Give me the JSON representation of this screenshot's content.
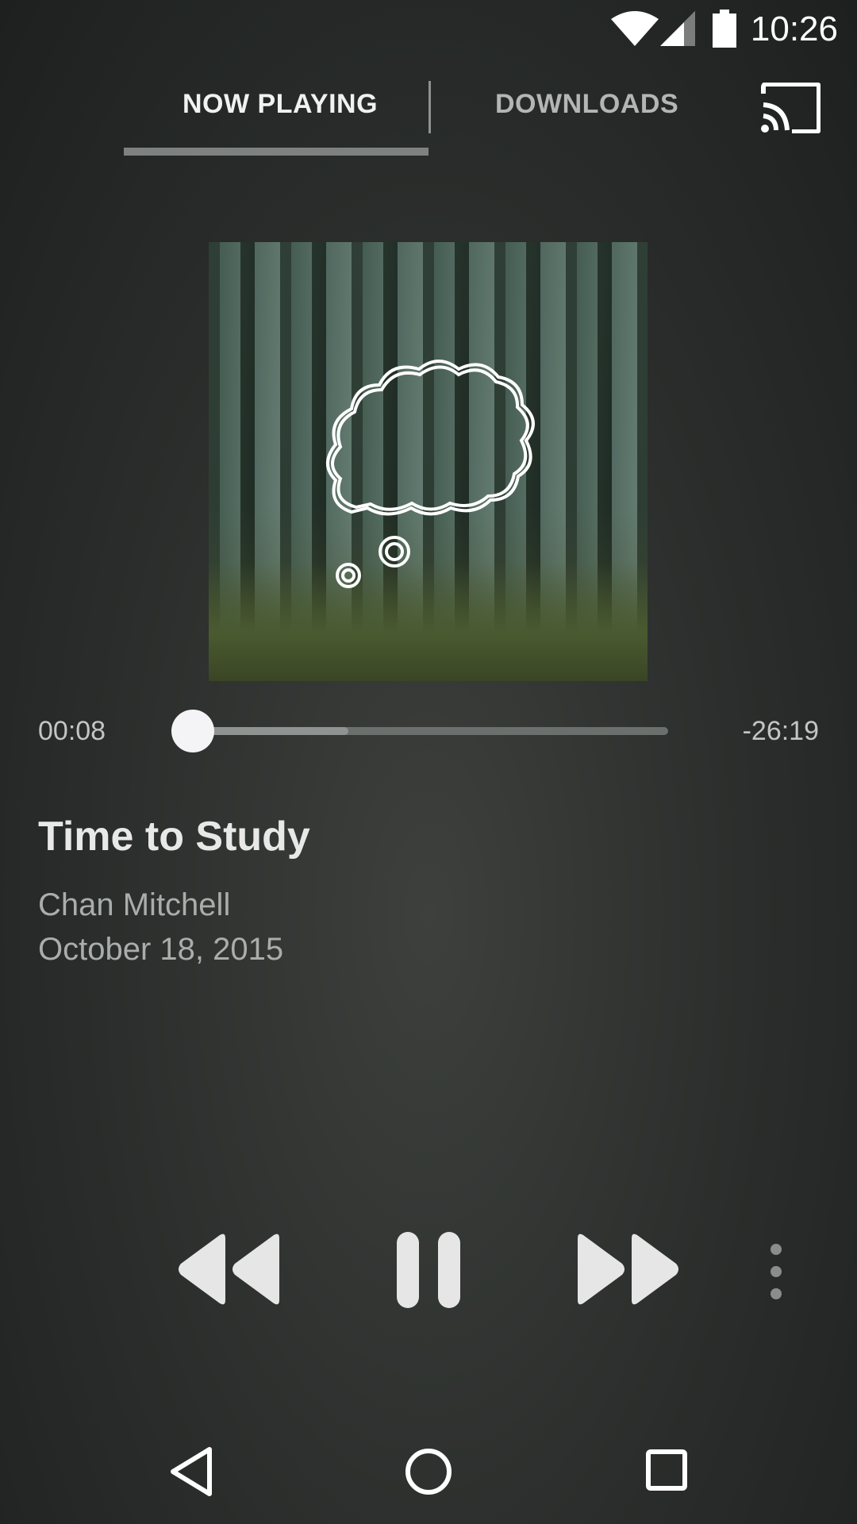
{
  "status_bar": {
    "time": "10:26",
    "icons": [
      "wifi-icon",
      "cell-signal-icon",
      "battery-icon"
    ]
  },
  "tabs": [
    {
      "label": "NOW PLAYING",
      "selected": true
    },
    {
      "label": "DOWNLOADS",
      "selected": false
    }
  ],
  "cast_icon": "cast-icon",
  "player": {
    "elapsed": "00:08",
    "remaining": "-26:19",
    "progress": 0.005,
    "buffered": 0.33
  },
  "episode": {
    "title": "Time to Study",
    "author": "Chan Mitchell",
    "date": "October 18, 2015"
  },
  "controls": [
    "rewind-icon",
    "pause-icon",
    "fast-forward-icon",
    "more-vert-icon"
  ],
  "nav_bar": [
    "back-icon",
    "home-icon",
    "recents-icon"
  ],
  "colors": {
    "accent_indicator": "#7d817f",
    "background": "#2a2d2b",
    "control": "#e6e6e6"
  }
}
